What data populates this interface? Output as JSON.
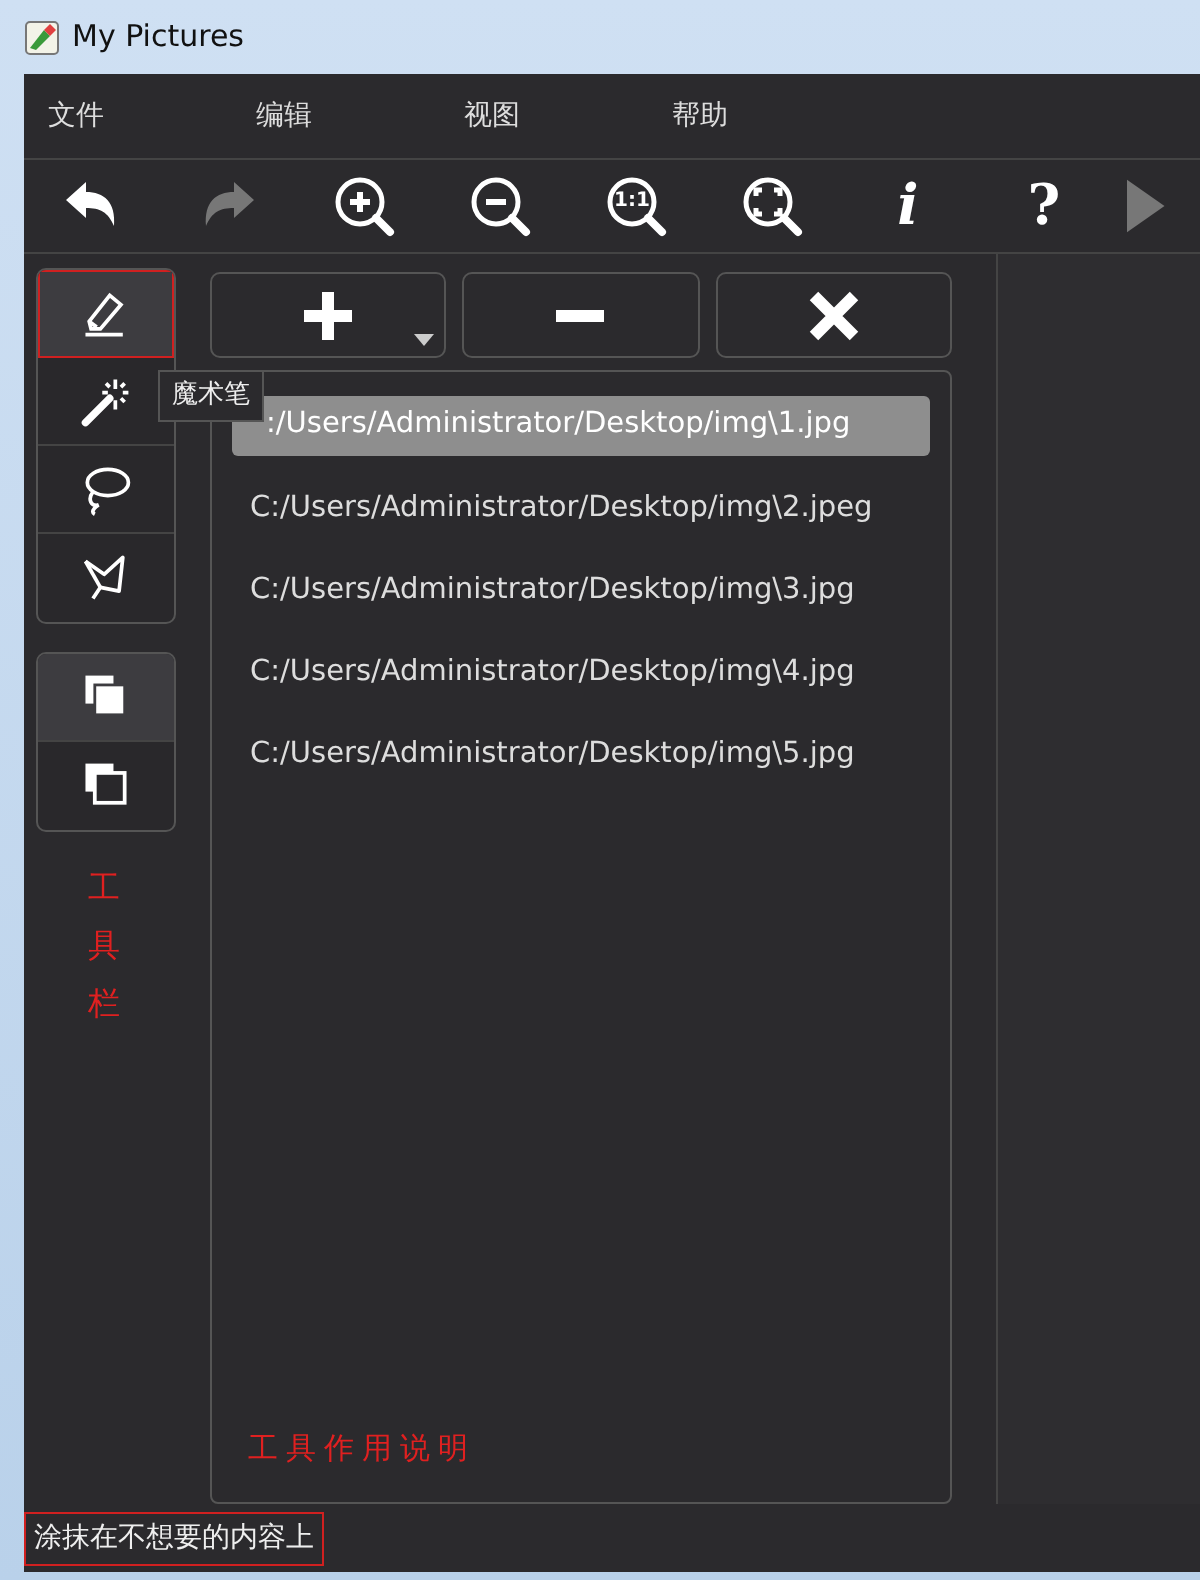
{
  "window": {
    "title": "My Pictures"
  },
  "menu": [
    "文件",
    "编辑",
    "视图",
    "帮助"
  ],
  "toolbar": [
    {
      "kind": "undo",
      "disabled": false
    },
    {
      "kind": "redo",
      "disabled": true
    },
    {
      "kind": "zoom_in",
      "disabled": false
    },
    {
      "kind": "zoom_out",
      "disabled": false
    },
    {
      "kind": "actual_size",
      "label": "1:1",
      "disabled": false
    },
    {
      "kind": "fit",
      "disabled": false
    },
    {
      "kind": "info",
      "label": "i",
      "disabled": false
    },
    {
      "kind": "help",
      "label": "?",
      "disabled": false
    },
    {
      "kind": "play",
      "disabled": true
    }
  ],
  "tools": [
    [
      {
        "kind": "eraser",
        "selected": true
      },
      {
        "kind": "wand",
        "selected": false
      },
      {
        "kind": "lasso",
        "selected": false
      },
      {
        "kind": "polygon",
        "selected": false
      }
    ],
    [
      {
        "kind": "add",
        "selected": true
      },
      {
        "kind": "subtract",
        "selected": false
      }
    ]
  ],
  "tooltip": "魔术笔",
  "list_buttons": [
    {
      "kind": "add",
      "dropdown": true
    },
    {
      "kind": "remove",
      "dropdown": false
    },
    {
      "kind": "clear",
      "dropdown": false
    }
  ],
  "files": [
    {
      "path": ":/Users/Administrator/Desktop/img\\1.jpg",
      "selected": true
    },
    {
      "path": "C:/Users/Administrator/Desktop/img\\2.jpeg",
      "selected": false
    },
    {
      "path": "C:/Users/Administrator/Desktop/img\\3.jpg",
      "selected": false
    },
    {
      "path": "C:/Users/Administrator/Desktop/img\\4.jpg",
      "selected": false
    },
    {
      "path": "C:/Users/Administrator/Desktop/img\\5.jpg",
      "selected": false
    }
  ],
  "annotations": {
    "toolbar_label": "工具栏",
    "status_label": "工具作用说明"
  },
  "status_bar": "涂抹在不想要的内容上"
}
